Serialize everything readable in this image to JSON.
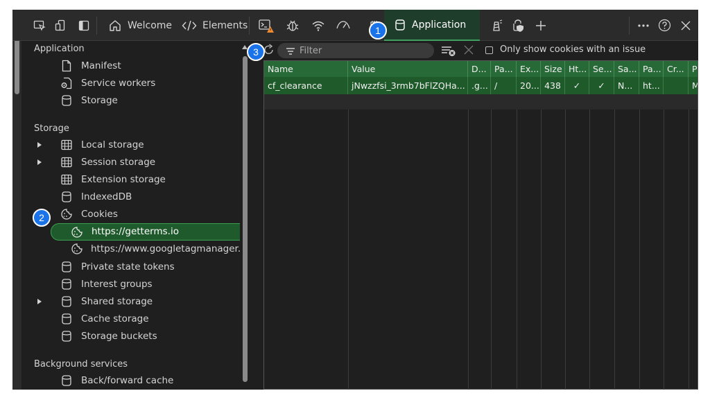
{
  "toolbar": {
    "tabs": [
      {
        "id": "welcome",
        "label": "Welcome",
        "icon": "home-icon"
      },
      {
        "id": "elements",
        "label": "Elements",
        "icon": "code-icon"
      },
      {
        "id": "application",
        "label": "Application",
        "icon": "cylinder-icon"
      }
    ],
    "badges": [
      "1",
      "2",
      "3"
    ]
  },
  "sidebar": {
    "sections": [
      {
        "title": "Application",
        "items": [
          {
            "label": "Manifest",
            "icon": "document-icon"
          },
          {
            "label": "Service workers",
            "icon": "gear-document-icon"
          },
          {
            "label": "Storage",
            "icon": "cylinder-icon"
          }
        ]
      },
      {
        "title": "Storage",
        "items": [
          {
            "label": "Local storage",
            "icon": "grid-icon",
            "expandable": true
          },
          {
            "label": "Session storage",
            "icon": "grid-icon",
            "expandable": true
          },
          {
            "label": "Extension storage",
            "icon": "grid-icon"
          },
          {
            "label": "IndexedDB",
            "icon": "cylinder-icon"
          },
          {
            "label": "Cookies",
            "icon": "cookie-icon",
            "expanded": true
          },
          {
            "label": "https://getterms.io",
            "icon": "cookie-icon",
            "selected": true
          },
          {
            "label": "https://www.googletagmanager.com",
            "icon": "cookie-icon"
          },
          {
            "label": "Private state tokens",
            "icon": "cylinder-icon"
          },
          {
            "label": "Interest groups",
            "icon": "cylinder-icon"
          },
          {
            "label": "Shared storage",
            "icon": "cylinder-icon",
            "expandable": true
          },
          {
            "label": "Cache storage",
            "icon": "cylinder-icon"
          },
          {
            "label": "Storage buckets",
            "icon": "cylinder-icon"
          }
        ]
      },
      {
        "title": "Background services",
        "items": [
          {
            "label": "Back/forward cache",
            "icon": "cylinder-icon"
          }
        ]
      }
    ]
  },
  "cookies": {
    "filter_placeholder": "Filter",
    "issue_only_label": "Only show cookies with an issue",
    "columns": [
      "Name",
      "Value",
      "D...",
      "Pa...",
      "Ex...",
      "Size",
      "Ht...",
      "Se...",
      "Sa...",
      "Pa...",
      "Cr...",
      "Pri..."
    ],
    "rows": [
      [
        "cf_clearance",
        "jNwzzfsi_3rmb7bFlZQHa...",
        ".g...",
        "/",
        "20...",
        "438",
        "✓",
        "✓",
        "N...",
        "ht...",
        "",
        "M..."
      ]
    ]
  },
  "colors": {
    "selection_green": "#1f5a2c",
    "header_green": "#286a37",
    "badge_blue": "#1a73e8",
    "warning_orange": "#f28b30"
  }
}
